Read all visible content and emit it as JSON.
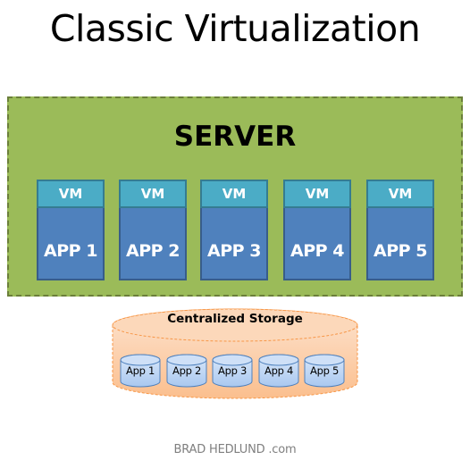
{
  "title": "Classic Virtualization",
  "server": {
    "label": "SERVER",
    "fill_color": "#9bbb59",
    "border_color": "#6b7f3a",
    "vms": [
      {
        "vm_label": "VM",
        "app_label": "APP 1"
      },
      {
        "vm_label": "VM",
        "app_label": "APP 2"
      },
      {
        "vm_label": "VM",
        "app_label": "APP 3"
      },
      {
        "vm_label": "VM",
        "app_label": "APP 4"
      },
      {
        "vm_label": "VM",
        "app_label": "APP 5"
      }
    ],
    "vm_color": "#4bacc6",
    "app_color": "#4f81bd"
  },
  "storage": {
    "label": "Centralized Storage",
    "fill_color": "#fac090",
    "disks": [
      {
        "label": "App 1"
      },
      {
        "label": "App 2"
      },
      {
        "label": "App 3"
      },
      {
        "label": "App 4"
      },
      {
        "label": "App 5"
      }
    ],
    "disk_color": "#b9d3f3"
  },
  "footer": "BRAD HEDLUND .com"
}
